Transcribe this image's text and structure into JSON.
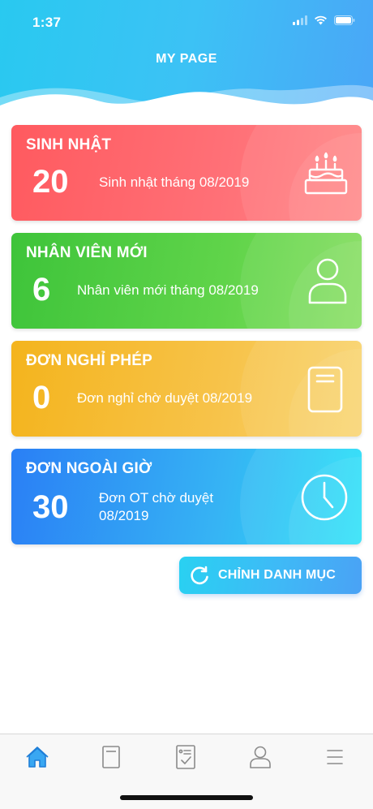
{
  "status_bar": {
    "time": "1:37"
  },
  "header": {
    "title": "MY PAGE"
  },
  "cards": [
    {
      "title": "SINH NHẬT",
      "count": "20",
      "description": "Sinh nhật tháng 08/2019",
      "icon": "cake-icon"
    },
    {
      "title": "NHÂN VIÊN MỚI",
      "count": "6",
      "description": "Nhân viên mới tháng 08/2019",
      "icon": "user-icon"
    },
    {
      "title": "ĐƠN NGHỈ PHÉP",
      "count": "0",
      "description": "Đơn nghỉ chờ duyệt 08/2019",
      "icon": "document-icon"
    },
    {
      "title": "ĐƠN NGOÀI GIỜ",
      "count": "30",
      "description_line1": "Đơn OT chờ duyệt",
      "description_line2": "08/2019",
      "icon": "clock-icon"
    }
  ],
  "edit_button": {
    "label": "CHỈNH DANH MỤC",
    "icon": "refresh-icon"
  },
  "tabbar": {
    "active_index": 0,
    "active_color": "#39a7f2",
    "inactive_color": "#8a8a8a",
    "items": [
      "home-icon",
      "document-icon",
      "checklist-icon",
      "profile-icon",
      "menu-icon"
    ]
  },
  "colors": {
    "birthday": "#ff5a5f",
    "new_employee": "#3ec43a",
    "leave": "#f4b41d",
    "overtime": "#2a7ff5",
    "accent": "#3fb9f6"
  }
}
